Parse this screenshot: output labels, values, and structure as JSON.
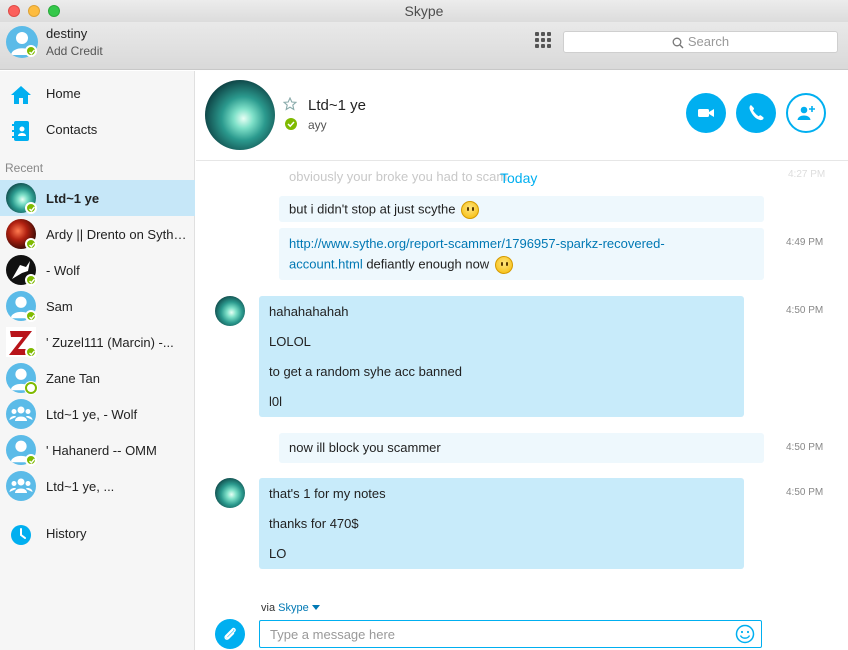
{
  "window": {
    "title": "Skype"
  },
  "account": {
    "name": "destiny",
    "credit_label": "Add Credit"
  },
  "search": {
    "placeholder": "Search"
  },
  "nav": {
    "home": "Home",
    "contacts": "Contacts",
    "history": "History"
  },
  "recent": {
    "title": "Recent",
    "contacts": [
      {
        "name": "Ltd~1 ye",
        "status": "online",
        "avatar": "photo-green"
      },
      {
        "name": "Ardy || Drento on Sythe ||",
        "status": "online",
        "avatar": "photo-red"
      },
      {
        "name": "- Wolf",
        "status": "online",
        "avatar": "photo-bw"
      },
      {
        "name": "Sam",
        "status": "online",
        "avatar": "default"
      },
      {
        "name": "' Zuzel111 (Marcin) -...",
        "status": "online",
        "avatar": "photo-z"
      },
      {
        "name": "Zane Tan",
        "status": "away",
        "avatar": "default"
      },
      {
        "name": "Ltd~1 ye, - Wolf",
        "status": "group",
        "avatar": "group"
      },
      {
        "name": "' Hahanerd -- OMM",
        "status": "online",
        "avatar": "default"
      },
      {
        "name": "Ltd~1 ye, ...",
        "status": "group",
        "avatar": "group"
      }
    ]
  },
  "conversation": {
    "name": "Ltd~1 ye",
    "mood": "ayy",
    "day_label": "Today",
    "faded_text": "obviously your broke you had to scam",
    "faded_time": "4:27 PM",
    "messages": [
      {
        "lines": [
          "but i didn't stop at just scythe"
        ],
        "time": "",
        "emoji": true
      },
      {
        "link": "http://www.sythe.org/report-scammer/1796957-sparkz-recovered-",
        "link2": "account.html",
        "rest": " defiantly enough now",
        "time": "4:49 PM",
        "emoji": true
      },
      {
        "lines": [
          "hahahahahah",
          "LOLOL",
          "to get a random syhe acc banned",
          "l0l"
        ],
        "time": "4:50 PM"
      },
      {
        "lines": [
          "now ill block you scammer"
        ],
        "time": "4:50 PM"
      },
      {
        "lines": [
          "that's 1 for my notes",
          "thanks for 470$",
          "LO"
        ],
        "time": "4:50 PM"
      }
    ]
  },
  "compose": {
    "via_label": "via",
    "via_service": "Skype",
    "placeholder": "Type a message here"
  },
  "colors": {
    "accent": "#00aff0",
    "online": "#7fba00",
    "selected": "#c6e7f8",
    "bubble": "#c8ebfa"
  }
}
